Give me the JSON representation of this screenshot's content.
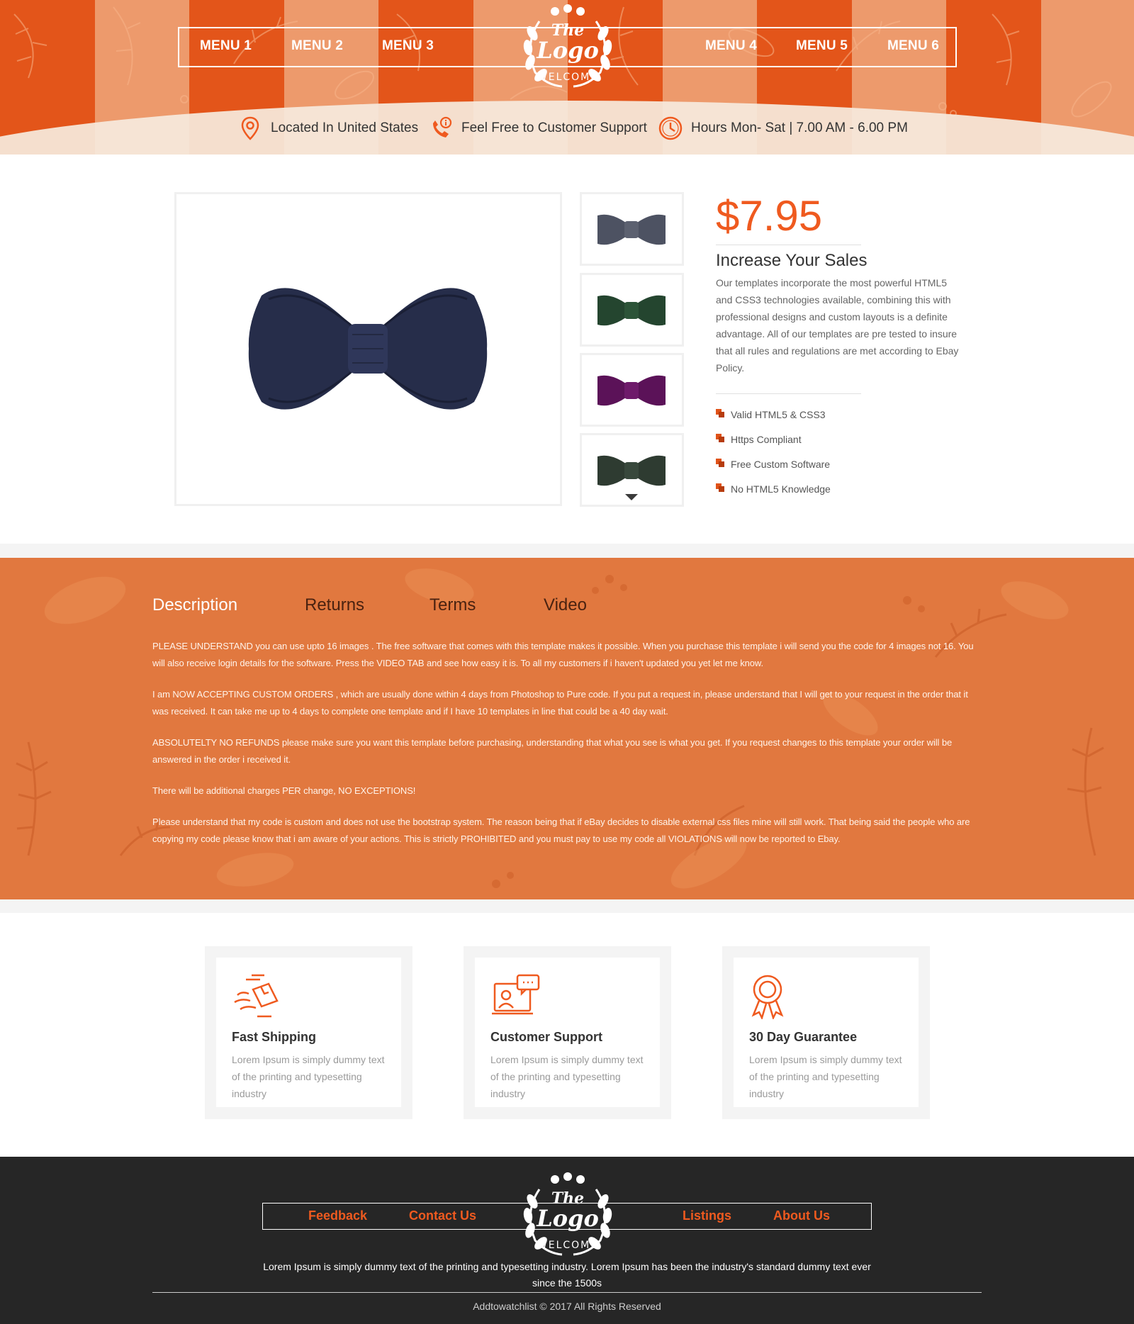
{
  "header": {
    "menu_left": [
      "MENU 1",
      "MENU 2",
      "MENU 3"
    ],
    "menu_right": [
      "MENU 4",
      "MENU 5",
      "MENU 6"
    ],
    "logo": {
      "line1": "The",
      "line2": "Logo",
      "line3": "WELCOME"
    },
    "info": [
      {
        "icon": "location-pin-icon",
        "text": "Located In United States"
      },
      {
        "icon": "phone-support-icon",
        "text": "Feel Free to Customer Support"
      },
      {
        "icon": "clock-icon",
        "text": "Hours Mon- Sat | 7.00 AM - 6.00 PM"
      }
    ]
  },
  "product": {
    "price": "$7.95",
    "title": "Increase Your Sales",
    "description": "Our templates incorporate the most powerful HTML5 and CSS3 technologies available, combining this with professional designs and custom layouts is a definite advantage. All of our templates are pre tested to insure that all rules and regulations are met according to Ebay Policy.",
    "features": [
      "Valid HTML5 & CSS3",
      "Https Compliant",
      "Free Custom Software",
      "No HTML5 Knowledge"
    ],
    "main_image_color": "#262d4a",
    "thumbnail_colors": [
      "#4d5262",
      "#24452f",
      "#5b1258",
      "#2e3b31"
    ]
  },
  "tabs": {
    "labels": [
      "Description",
      "Returns",
      "Terms",
      "Video"
    ],
    "active": "Description",
    "paragraphs": [
      "PLEASE UNDERSTAND you can use upto 16 images . The free software that comes with this template makes it possible. When you purchase this template i will send you the code for 4 images not 16. You will also receive login details for the software. Press the VIDEO TAB and see how easy it is. To all my customers if i haven't updated you yet let me know.",
      "I am  NOW ACCEPTING CUSTOM ORDERS , which are usually done within 4 days from Photoshop to Pure code. If you put a request in, please understand that I will get to your request in the order that it was received. It can take me up to 4 days to complete one template and if I have 10 templates in line that could be a 40 day wait.",
      "ABSOLUTELTY NO REFUNDS  please make sure you want this template before purchasing, understanding that what you see is what you get. If you request changes to this template your order will be answered in the order i received it.",
      "There will be additional charges PER change, NO EXCEPTIONS!",
      "Please understand that my code is custom and does not use the bootstrap system. The reason being that if eBay decides to disable external css files mine will still work. That being said the people who are copying my code please know that i am aware of your actions. This is strictly PROHIBITED and you must pay to use my code all VIOLATIONS will now be reported to Ebay."
    ]
  },
  "features": [
    {
      "icon": "fast-shipping-icon",
      "title": "Fast Shipping",
      "text": "Lorem Ipsum is simply dummy text of the printing and typesetting industry"
    },
    {
      "icon": "customer-support-icon",
      "title": "Customer Support",
      "text": "Lorem Ipsum is simply dummy text of the printing and typesetting industry"
    },
    {
      "icon": "award-ribbon-icon",
      "title": "30 Day Guarantee",
      "text": "Lorem Ipsum is simply dummy text of the printing and typesetting industry"
    }
  ],
  "footer": {
    "links_left": [
      "Feedback",
      "Contact Us"
    ],
    "links_right": [
      "Listings",
      "About Us"
    ],
    "text": "Lorem Ipsum is simply dummy text of the printing and typesetting industry. Lorem Ipsum has been the industry's standard dummy text ever since the 1500s",
    "copyright": "Addtowatchlist © 2017 All Rights Reserved"
  },
  "colors": {
    "accent": "#ef5a1f",
    "band": "#e1783f",
    "footer_bg": "#262626"
  }
}
